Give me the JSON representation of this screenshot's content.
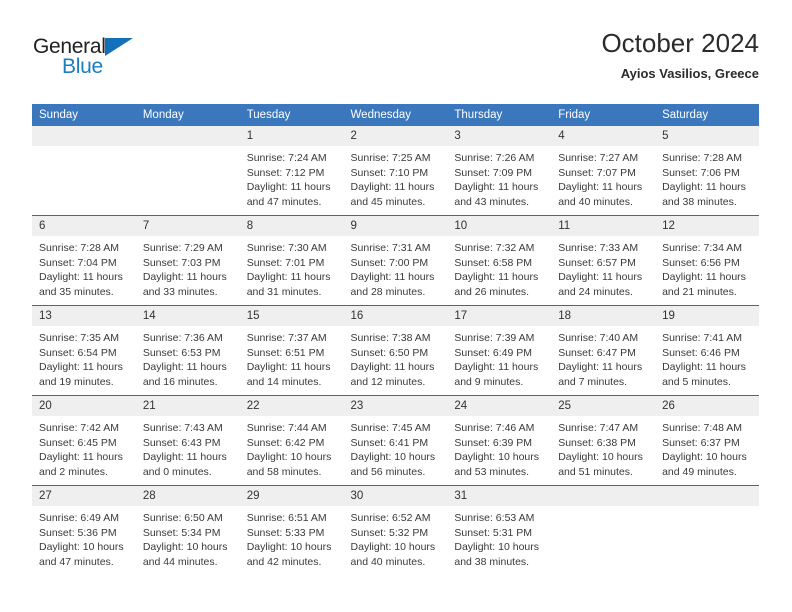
{
  "brand": {
    "name_part1": "General",
    "name_part2": "Blue",
    "flag_icon": "triangle-flag-icon",
    "color": "#1a7fc1"
  },
  "header": {
    "title": "October 2024",
    "subtitle": "Ayios Vasilios, Greece"
  },
  "theme": {
    "header_bg": "#3b77bc",
    "row_divider": "#2e6daf",
    "daynum_bg": "#efefef",
    "text": "#3a3a3a"
  },
  "weekday_headers": [
    "Sunday",
    "Monday",
    "Tuesday",
    "Wednesday",
    "Thursday",
    "Friday",
    "Saturday"
  ],
  "labels": {
    "sunrise": "Sunrise:",
    "sunset": "Sunset:",
    "daylight": "Daylight:"
  },
  "weeks": [
    [
      {
        "day": "",
        "empty": true
      },
      {
        "day": "",
        "empty": true
      },
      {
        "day": "1",
        "sunrise": "Sunrise: 7:24 AM",
        "sunset": "Sunset: 7:12 PM",
        "daylight": "Daylight: 11 hours and 47 minutes."
      },
      {
        "day": "2",
        "sunrise": "Sunrise: 7:25 AM",
        "sunset": "Sunset: 7:10 PM",
        "daylight": "Daylight: 11 hours and 45 minutes."
      },
      {
        "day": "3",
        "sunrise": "Sunrise: 7:26 AM",
        "sunset": "Sunset: 7:09 PM",
        "daylight": "Daylight: 11 hours and 43 minutes."
      },
      {
        "day": "4",
        "sunrise": "Sunrise: 7:27 AM",
        "sunset": "Sunset: 7:07 PM",
        "daylight": "Daylight: 11 hours and 40 minutes."
      },
      {
        "day": "5",
        "sunrise": "Sunrise: 7:28 AM",
        "sunset": "Sunset: 7:06 PM",
        "daylight": "Daylight: 11 hours and 38 minutes."
      }
    ],
    [
      {
        "day": "6",
        "sunrise": "Sunrise: 7:28 AM",
        "sunset": "Sunset: 7:04 PM",
        "daylight": "Daylight: 11 hours and 35 minutes."
      },
      {
        "day": "7",
        "sunrise": "Sunrise: 7:29 AM",
        "sunset": "Sunset: 7:03 PM",
        "daylight": "Daylight: 11 hours and 33 minutes."
      },
      {
        "day": "8",
        "sunrise": "Sunrise: 7:30 AM",
        "sunset": "Sunset: 7:01 PM",
        "daylight": "Daylight: 11 hours and 31 minutes."
      },
      {
        "day": "9",
        "sunrise": "Sunrise: 7:31 AM",
        "sunset": "Sunset: 7:00 PM",
        "daylight": "Daylight: 11 hours and 28 minutes."
      },
      {
        "day": "10",
        "sunrise": "Sunrise: 7:32 AM",
        "sunset": "Sunset: 6:58 PM",
        "daylight": "Daylight: 11 hours and 26 minutes."
      },
      {
        "day": "11",
        "sunrise": "Sunrise: 7:33 AM",
        "sunset": "Sunset: 6:57 PM",
        "daylight": "Daylight: 11 hours and 24 minutes."
      },
      {
        "day": "12",
        "sunrise": "Sunrise: 7:34 AM",
        "sunset": "Sunset: 6:56 PM",
        "daylight": "Daylight: 11 hours and 21 minutes."
      }
    ],
    [
      {
        "day": "13",
        "sunrise": "Sunrise: 7:35 AM",
        "sunset": "Sunset: 6:54 PM",
        "daylight": "Daylight: 11 hours and 19 minutes."
      },
      {
        "day": "14",
        "sunrise": "Sunrise: 7:36 AM",
        "sunset": "Sunset: 6:53 PM",
        "daylight": "Daylight: 11 hours and 16 minutes."
      },
      {
        "day": "15",
        "sunrise": "Sunrise: 7:37 AM",
        "sunset": "Sunset: 6:51 PM",
        "daylight": "Daylight: 11 hours and 14 minutes."
      },
      {
        "day": "16",
        "sunrise": "Sunrise: 7:38 AM",
        "sunset": "Sunset: 6:50 PM",
        "daylight": "Daylight: 11 hours and 12 minutes."
      },
      {
        "day": "17",
        "sunrise": "Sunrise: 7:39 AM",
        "sunset": "Sunset: 6:49 PM",
        "daylight": "Daylight: 11 hours and 9 minutes."
      },
      {
        "day": "18",
        "sunrise": "Sunrise: 7:40 AM",
        "sunset": "Sunset: 6:47 PM",
        "daylight": "Daylight: 11 hours and 7 minutes."
      },
      {
        "day": "19",
        "sunrise": "Sunrise: 7:41 AM",
        "sunset": "Sunset: 6:46 PM",
        "daylight": "Daylight: 11 hours and 5 minutes."
      }
    ],
    [
      {
        "day": "20",
        "sunrise": "Sunrise: 7:42 AM",
        "sunset": "Sunset: 6:45 PM",
        "daylight": "Daylight: 11 hours and 2 minutes."
      },
      {
        "day": "21",
        "sunrise": "Sunrise: 7:43 AM",
        "sunset": "Sunset: 6:43 PM",
        "daylight": "Daylight: 11 hours and 0 minutes."
      },
      {
        "day": "22",
        "sunrise": "Sunrise: 7:44 AM",
        "sunset": "Sunset: 6:42 PM",
        "daylight": "Daylight: 10 hours and 58 minutes."
      },
      {
        "day": "23",
        "sunrise": "Sunrise: 7:45 AM",
        "sunset": "Sunset: 6:41 PM",
        "daylight": "Daylight: 10 hours and 56 minutes."
      },
      {
        "day": "24",
        "sunrise": "Sunrise: 7:46 AM",
        "sunset": "Sunset: 6:39 PM",
        "daylight": "Daylight: 10 hours and 53 minutes."
      },
      {
        "day": "25",
        "sunrise": "Sunrise: 7:47 AM",
        "sunset": "Sunset: 6:38 PM",
        "daylight": "Daylight: 10 hours and 51 minutes."
      },
      {
        "day": "26",
        "sunrise": "Sunrise: 7:48 AM",
        "sunset": "Sunset: 6:37 PM",
        "daylight": "Daylight: 10 hours and 49 minutes."
      }
    ],
    [
      {
        "day": "27",
        "sunrise": "Sunrise: 6:49 AM",
        "sunset": "Sunset: 5:36 PM",
        "daylight": "Daylight: 10 hours and 47 minutes."
      },
      {
        "day": "28",
        "sunrise": "Sunrise: 6:50 AM",
        "sunset": "Sunset: 5:34 PM",
        "daylight": "Daylight: 10 hours and 44 minutes."
      },
      {
        "day": "29",
        "sunrise": "Sunrise: 6:51 AM",
        "sunset": "Sunset: 5:33 PM",
        "daylight": "Daylight: 10 hours and 42 minutes."
      },
      {
        "day": "30",
        "sunrise": "Sunrise: 6:52 AM",
        "sunset": "Sunset: 5:32 PM",
        "daylight": "Daylight: 10 hours and 40 minutes."
      },
      {
        "day": "31",
        "sunrise": "Sunrise: 6:53 AM",
        "sunset": "Sunset: 5:31 PM",
        "daylight": "Daylight: 10 hours and 38 minutes."
      },
      {
        "day": "",
        "empty": true
      },
      {
        "day": "",
        "empty": true
      }
    ]
  ]
}
